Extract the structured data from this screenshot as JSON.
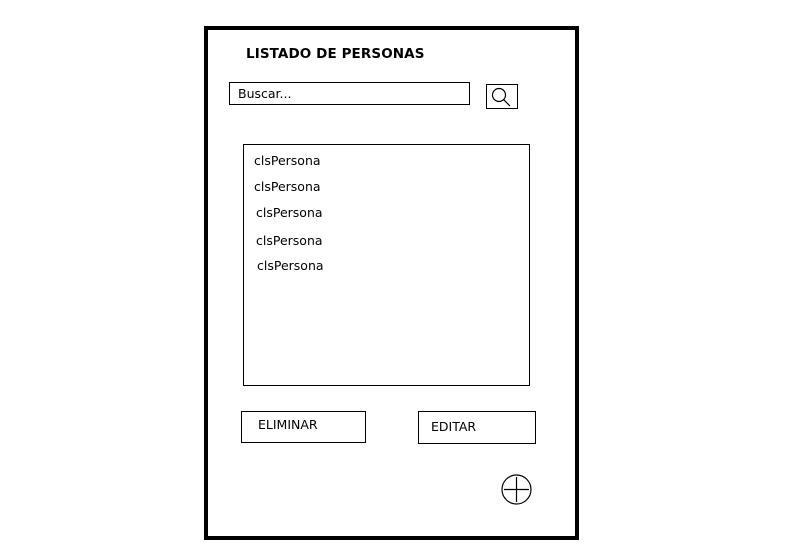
{
  "page": {
    "title": "LISTADO DE PERSONAS"
  },
  "search": {
    "placeholder": "Buscar...",
    "value": "",
    "icon": "magnifier-icon"
  },
  "list": {
    "items": [
      {
        "label": "clsPersona"
      },
      {
        "label": "clsPersona"
      },
      {
        "label": "clsPersona"
      },
      {
        "label": "clsPersona"
      },
      {
        "label": "clsPersona"
      }
    ]
  },
  "actions": {
    "delete_label": "ELIMINAR",
    "edit_label": "EDITAR",
    "add_icon": "plus-circle-icon"
  },
  "colors": {
    "border": "#000000",
    "background": "#ffffff",
    "text": "#000000"
  }
}
